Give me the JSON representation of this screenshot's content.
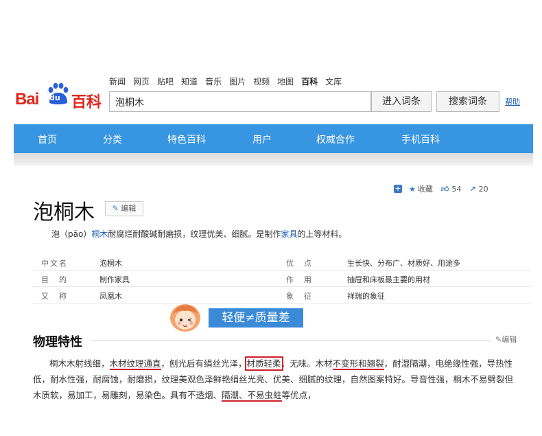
{
  "topnav": [
    "新闻",
    "网页",
    "贴吧",
    "知道",
    "音乐",
    "图片",
    "视频",
    "地图",
    "百科",
    "文库"
  ],
  "topnav_active": "百科",
  "logo": {
    "bai": "Bai",
    "du": "du",
    "baike": "百科"
  },
  "search": {
    "value": "泡桐木"
  },
  "buttons": {
    "enter": "进入词条",
    "search": "搜索词条",
    "help": "帮助"
  },
  "mainnav": [
    "首页",
    "分类",
    "特色百科",
    "用户",
    "权威合作",
    "手机百科"
  ],
  "tools": {
    "collect": "收藏",
    "likes": "54",
    "shares": "20"
  },
  "title": "泡桐木",
  "edit": "编辑",
  "summary": {
    "pre": "泡（pāo）",
    "link1": "桐木",
    "mid": "耐腐烂耐酸碱耐磨损，纹理优美、细腻。是制作",
    "link2": "家具",
    "post": "的上等材料。"
  },
  "info": [
    {
      "k1": "中文名",
      "v1": "泡桐木",
      "k2": "优　点",
      "v2": "生长快、分布广、材质好、用途多"
    },
    {
      "k1": "目　的",
      "v1": "制作家具",
      "k2": "作　用",
      "v2": "抽屉和床板最主要的用材"
    },
    {
      "k1": "又　称",
      "v1": "凤凰木",
      "k2": "象　征",
      "v2": "祥瑞的象征"
    }
  ],
  "banner": {
    "slogan": "轻便≠质量差"
  },
  "section": {
    "title": "物理特性",
    "edit": "编辑"
  },
  "para": {
    "s1": "桐木木射线细，",
    "u1": "木材纹理通直",
    "s2": "，刨光后有绢丝光泽，",
    "u2": "材质轻柔",
    "s3": "，无味。木材",
    "u3": "不变形和翘裂",
    "s4": "，耐湿隔潮，电绝缘性强，导热性低，耐水性强，耐腐蚀，耐磨损，纹理美观色泽鲜艳绢丝光亮、优美、细腻的纹理，自然图案特好。导音性强，桐木不易劈裂但木质软，易加工，易雕刻，易染色。具有不透烟、",
    "u4": "隔潮、不易虫蛀",
    "s5": "等优点，"
  },
  "colors": {
    "nav": "#3795e1",
    "logo_red": "#e1251b",
    "link": "#1a5cb8",
    "highlight": "#d0202b"
  }
}
